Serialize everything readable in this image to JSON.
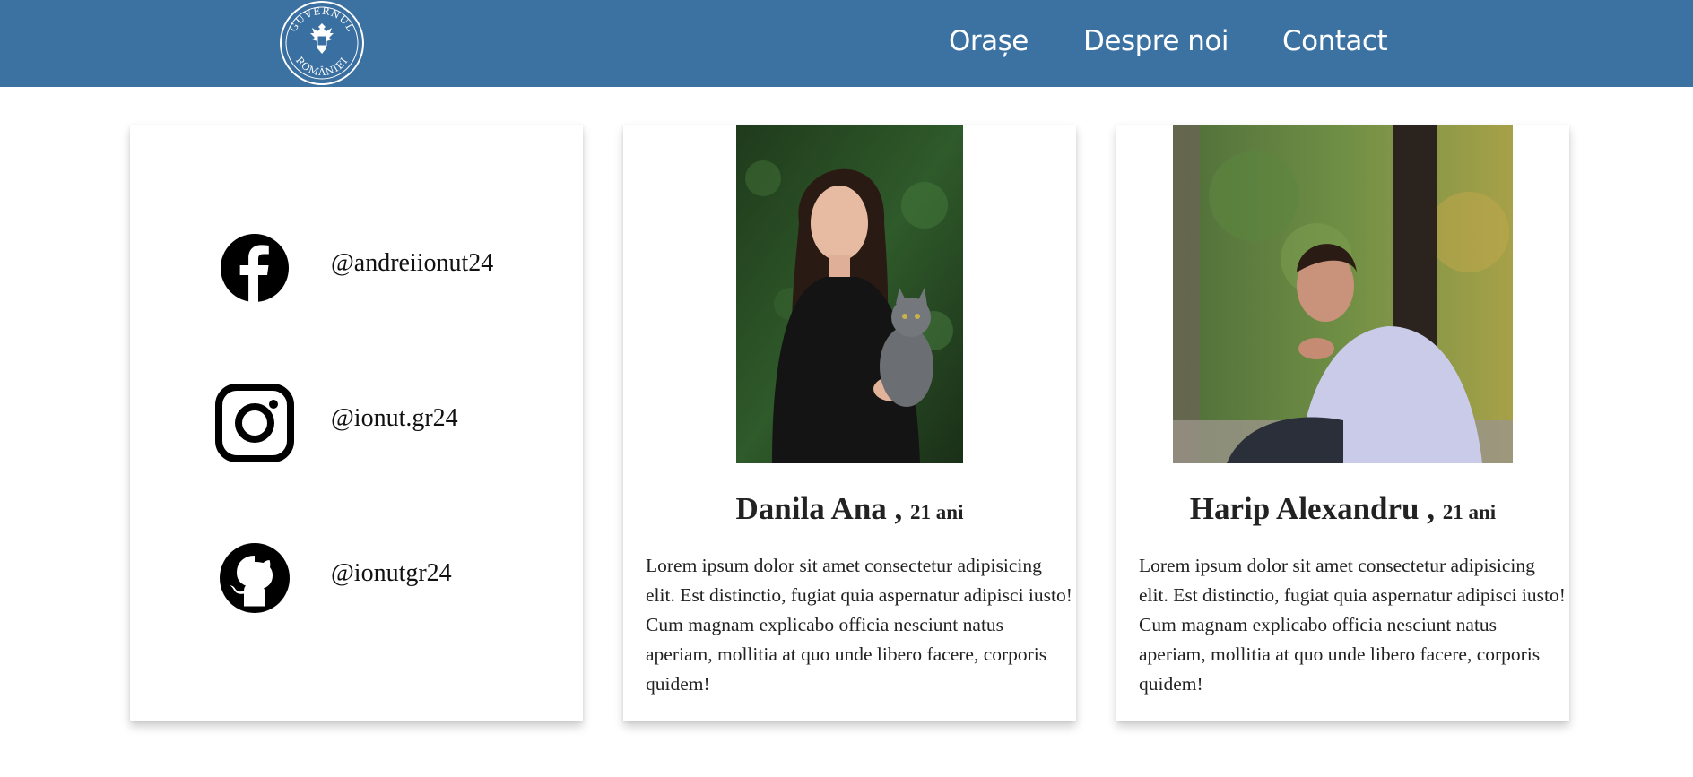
{
  "header": {
    "logo_top_text": "GUVERNUL",
    "logo_bottom_text": "ROMÂNIEI",
    "nav": [
      {
        "label": "Orașe"
      },
      {
        "label": "Despre noi"
      },
      {
        "label": "Contact"
      }
    ]
  },
  "social": [
    {
      "icon": "facebook-icon",
      "handle": "@andreiionut24"
    },
    {
      "icon": "instagram-icon",
      "handle": "@ionut.gr24"
    },
    {
      "icon": "github-icon",
      "handle": "@ionutgr24"
    }
  ],
  "people": [
    {
      "name": "Danila Ana",
      "separator": " ,",
      "age": "21 ani",
      "bio": "Lorem ipsum dolor sit amet consectetur adipisicing elit. Est distinctio, fugiat quia aspernatur adipisci iusto! Cum magnam explicabo officia nesciunt natus aperiam, mollitia at quo unde libero facere, corporis quidem!"
    },
    {
      "name": "Harip Alexandru",
      "separator": " ,",
      "age": "21 ani",
      "bio": "Lorem ipsum dolor sit amet consectetur adipisicing elit. Est distinctio, fugiat quia aspernatur adipisci iusto! Cum magnam explicabo officia nesciunt natus aperiam, mollitia at quo unde libero facere, corporis quidem!"
    }
  ],
  "colors": {
    "navbar": "#3c72a2",
    "nav_text": "#ffffff",
    "text": "#222222"
  }
}
